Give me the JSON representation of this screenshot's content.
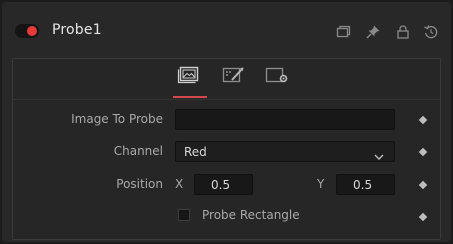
{
  "node": {
    "title": "Probe1",
    "active": true,
    "accent": "#e63a3a"
  },
  "header_icons": [
    "window-icon",
    "pin-icon",
    "lock-icon",
    "reset-icon"
  ],
  "tabs": [
    {
      "name": "image-tab-icon",
      "active": true
    },
    {
      "name": "controls-tab-icon",
      "active": false
    },
    {
      "name": "settings-tab-icon",
      "active": false
    }
  ],
  "controls": {
    "image_to_probe": {
      "label": "Image To Probe",
      "value": ""
    },
    "channel": {
      "label": "Channel",
      "value": "Red"
    },
    "position": {
      "label": "Position",
      "x_label": "X",
      "x_value": "0.5",
      "y_label": "Y",
      "y_value": "0.5"
    },
    "probe_rectangle": {
      "label": "Probe Rectangle",
      "checked": false
    }
  }
}
